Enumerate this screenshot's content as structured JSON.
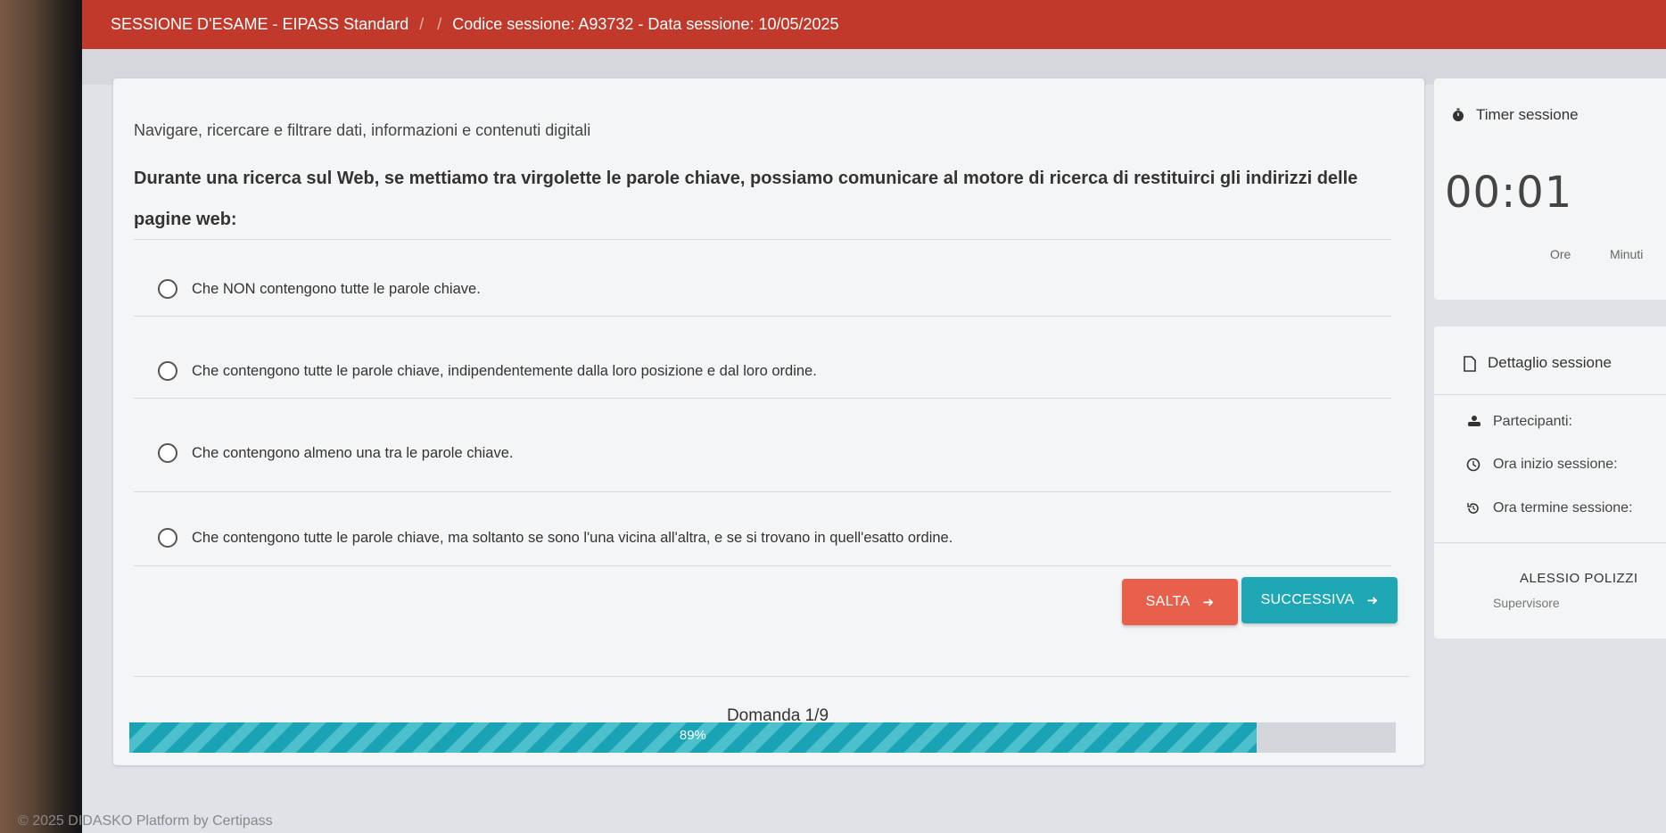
{
  "header": {
    "exam_title": "SESSIONE D'ESAME - EIPASS Standard",
    "session_info": "Codice sessione: A93732 - Data sessione: 10/05/2025"
  },
  "question": {
    "category": "Navigare, ricercare e filtrare dati, informazioni e contenuti digitali",
    "text": "Durante una ricerca sul Web, se mettiamo tra virgolette le parole chiave, possiamo comunicare al motore di ricerca di restituirci gli indirizzi delle pagine web:",
    "options": [
      "Che NON contengono tutte le parole chiave.",
      "Che contengono tutte le parole chiave, indipendentemente dalla loro posizione e dal loro ordine.",
      "Che contengono almeno una tra le parole chiave.",
      "Che contengono tutte le parole chiave, ma soltanto se sono l'una vicina all'altra, e se si trovano in quell'esatto ordine."
    ]
  },
  "actions": {
    "skip_label": "SALTA",
    "next_label": "SUCCESSIVA",
    "arrow": "➜"
  },
  "progress": {
    "counter": "Domanda 1/9",
    "percent_label": "89%",
    "fraction": 0.89
  },
  "timer": {
    "title": "Timer sessione",
    "value": "00:01",
    "unit_hours": "Ore",
    "unit_minutes": "Minuti"
  },
  "session_detail": {
    "title": "Dettaglio sessione",
    "participants_label": "Partecipanti:",
    "start_label": "Ora inizio sessione:",
    "end_label": "Ora termine sessione:",
    "supervisor_name": "ALESSIO POLIZZI",
    "supervisor_role": "Supervisore"
  },
  "footer": {
    "text": "© 2025  DIDASKO Platform by Certipass"
  },
  "colors": {
    "topbar": "#c0392b",
    "skip_button": "#e8604c",
    "next_button": "#20a7b6",
    "progress": "#1aa3b5"
  }
}
